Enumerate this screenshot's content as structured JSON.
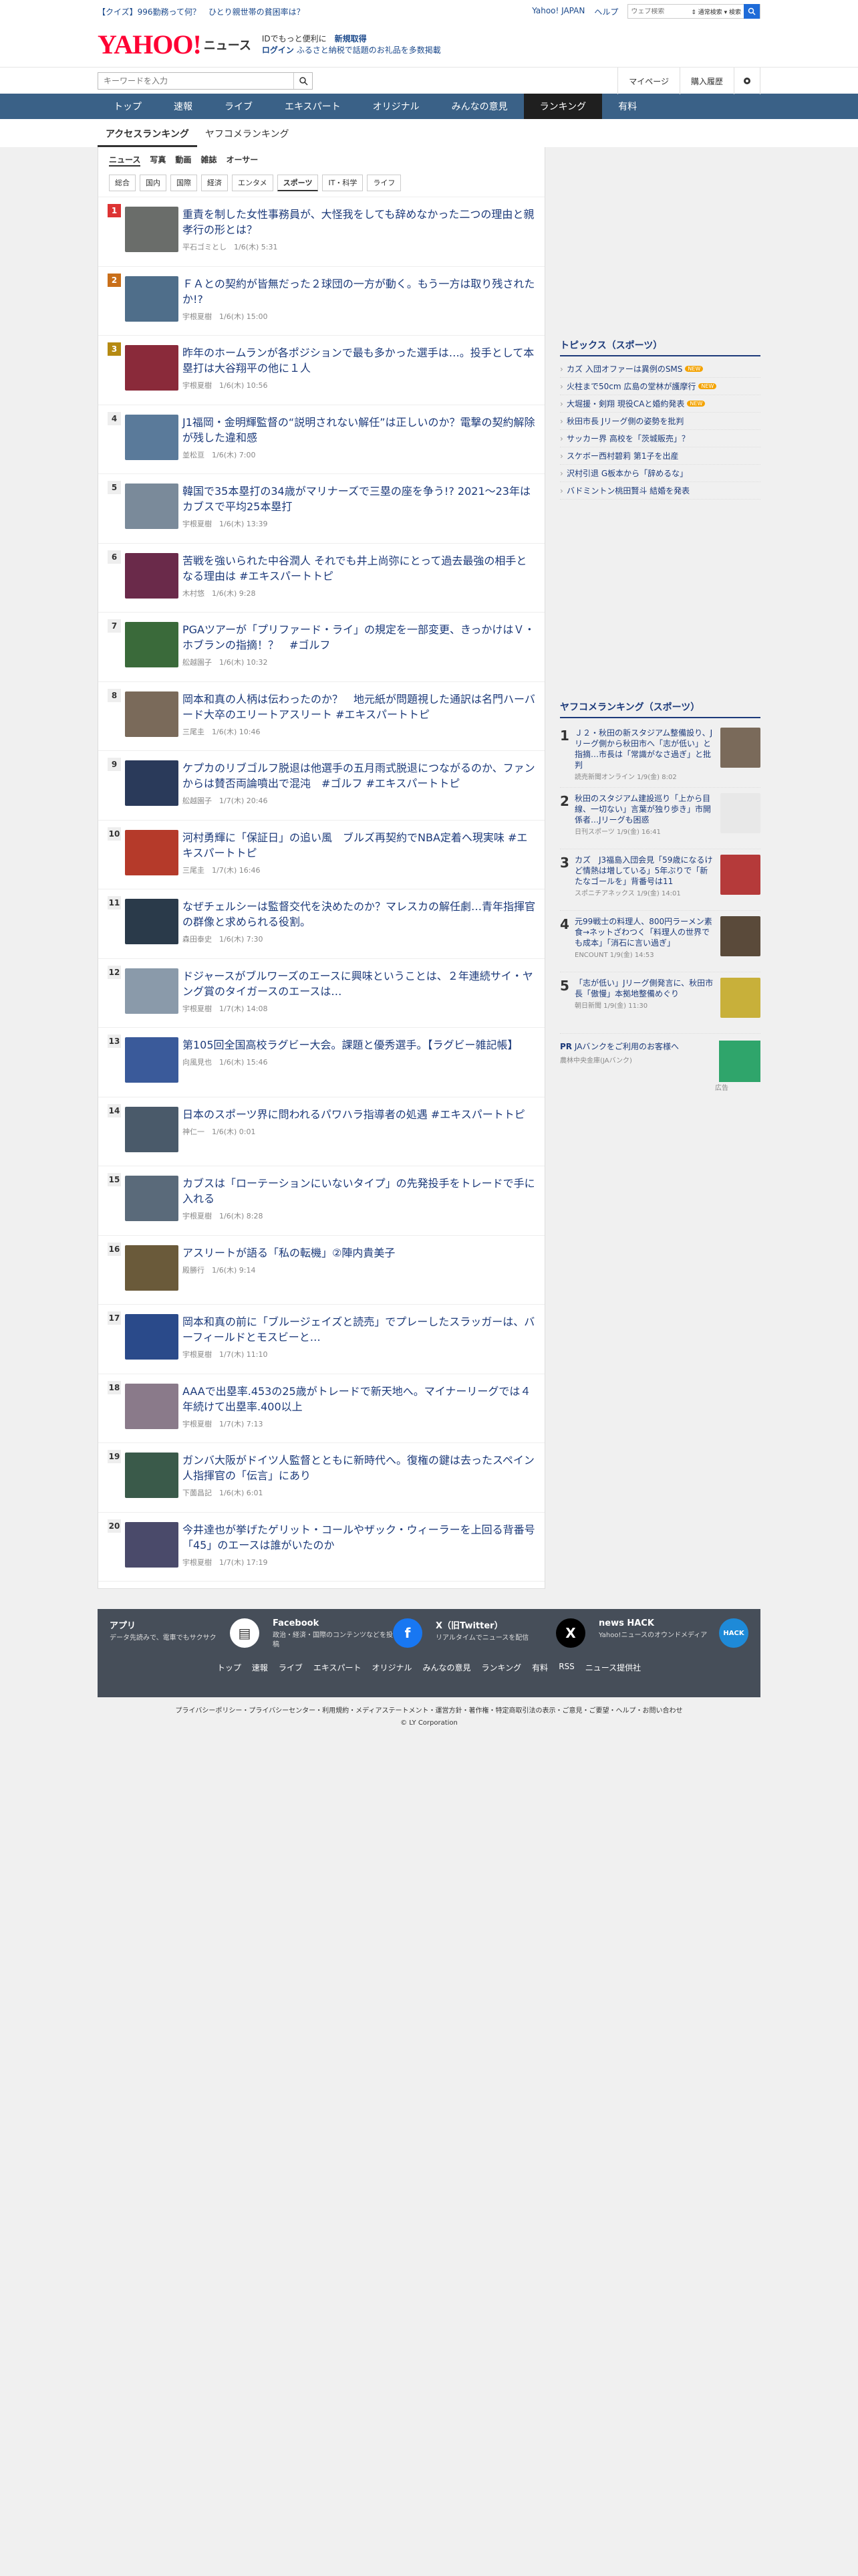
{
  "topbar": {
    "news": "【クイズ】996勤務って何？　ひとり親世帯の貧困率は？",
    "links": [
      "Yahoo! JAPAN",
      "ヘルプ"
    ],
    "search_placeholder": "ウェブ検索",
    "search_option": "⇕ 通常検索 ▾ 検索"
  },
  "header": {
    "logo": "YAHOO!",
    "logo_sub": "JAPAN",
    "brand": "ニュース",
    "promo1": "IDでもっと便利に",
    "promo1b": "新規取得",
    "promo2a": "ログイン",
    "promo2b": "ふるさと納税で話題のお礼品を多数掲載"
  },
  "subbar": {
    "placeholder": "キーワードを入力",
    "mypage": "マイページ",
    "history": "購入履歴"
  },
  "gnav": [
    "トップ",
    "速報",
    "ライブ",
    "エキスパート",
    "オリジナル",
    "みんなの意見",
    "ランキング",
    "有料"
  ],
  "tabs": [
    "アクセスランキング",
    "ヤフコメランキング"
  ],
  "cats": [
    "ニュース",
    "写真",
    "動画",
    "雑誌",
    "オーサー"
  ],
  "subcats": [
    "総合",
    "国内",
    "国際",
    "経済",
    "エンタメ",
    "スポーツ",
    "IT・科学",
    "ライフ"
  ],
  "ranking": [
    {
      "n": "1",
      "title": "重責を制した女性事務員が、大怪我をしても辞めなかった二つの理由と親孝行の形とは？",
      "meta": "平石ゴミとし　1/6(木) 5:31",
      "color": "#d33",
      "thumb": "#6a6d6a"
    },
    {
      "n": "2",
      "title": "ＦＡとの契約が皆無だった２球団の一方が動く。もう一方は取り残されたか!?",
      "meta": "宇根夏樹　1/6(木) 15:00",
      "color": "#c96f1a",
      "thumb": "#4f6e8a"
    },
    {
      "n": "3",
      "title": "昨年のホームランが各ポジションで最も多かった選手は…。投手として本塁打は大谷翔平の他に１人",
      "meta": "宇根夏樹　1/6(木) 10:56",
      "color": "#b58a12",
      "thumb": "#8a2a3a"
    },
    {
      "n": "4",
      "title": "J1福岡・金明輝監督の“説明されない解任”は正しいのか？電撃の契約解除が残した違和感",
      "meta": "並松亘　1/6(木) 7:00",
      "color": "",
      "thumb": "#5a7a9a"
    },
    {
      "n": "5",
      "title": "韓国で35本塁打の34歳がマリナーズで三塁の座を争う!? 2021～23年はカブスで平均25本塁打",
      "meta": "宇根夏樹　1/6(木) 13:39",
      "color": "",
      "thumb": "#7a8a9a"
    },
    {
      "n": "6",
      "title": "苦戦を強いられた中谷潤人 それでも井上尚弥にとって過去最強の相手となる理由は #エキスパートトピ",
      "meta": "木村悠　1/6(木) 9:28",
      "color": "",
      "thumb": "#6a2a4a"
    },
    {
      "n": "7",
      "title": "PGAツアーが「プリファード・ライ」の規定を一部変更、きっかけはＶ・ホブランの指摘！？　#ゴルフ",
      "meta": "舩越園子　1/6(木) 10:32",
      "color": "",
      "thumb": "#3a6a3a"
    },
    {
      "n": "8",
      "title": "岡本和真の人柄は伝わったのか？　地元紙が問題視した通訳は名門ハーバード大卒のエリートアスリート #エキスパートトピ",
      "meta": "三尾圭　1/6(木) 10:46",
      "color": "",
      "thumb": "#7a6a5a"
    },
    {
      "n": "9",
      "title": "ケプカのリブゴルフ脱退は他選手の五月雨式脱退につながるのか、ファンからは賛否両論噴出で混沌　#ゴルフ #エキスパートトピ",
      "meta": "舩越園子　1/7(木) 20:46",
      "color": "",
      "thumb": "#2a3a5a"
    },
    {
      "n": "10",
      "title": "河村勇輝に「保証日」の追い風　ブルズ再契約でNBA定着へ現実味 #エキスパートトピ",
      "meta": "三尾圭　1/7(木) 16:46",
      "color": "",
      "thumb": "#b53a2a"
    },
    {
      "n": "11",
      "title": "なぜチェルシーは監督交代を決めたのか？マレスカの解任劇…青年指揮官の群像と求められる役割。",
      "meta": "森田泰史　1/6(木) 7:30",
      "color": "",
      "thumb": "#2a3a4a"
    },
    {
      "n": "12",
      "title": "ドジャースがブルワーズのエースに興味ということは、２年連続サイ・ヤング賞のタイガースのエースは…",
      "meta": "宇根夏樹　1/7(木) 14:08",
      "color": "",
      "thumb": "#8a9aaa"
    },
    {
      "n": "13",
      "title": "第105回全国高校ラグビー大会。課題と優秀選手。【ラグビー雑記帳】",
      "meta": "向風見也　1/6(木) 15:46",
      "color": "",
      "thumb": "#3a5a9a"
    },
    {
      "n": "14",
      "title": "日本のスポーツ界に問われるパワハラ指導者の処遇 #エキスパートトピ",
      "meta": "神仁一　1/6(木) 0:01",
      "color": "",
      "thumb": "#4a5a6a"
    },
    {
      "n": "15",
      "title": "カブスは「ローテーションにいないタイプ」の先発投手をトレードで手に入れる",
      "meta": "宇根夏樹　1/6(木) 8:28",
      "color": "",
      "thumb": "#5a6a7a"
    },
    {
      "n": "16",
      "title": "アスリートが語る「私の転機」②陣内貴美子",
      "meta": "殿勝行　1/6(木) 9:14",
      "color": "",
      "thumb": "#6a5a3a"
    },
    {
      "n": "17",
      "title": "岡本和真の前に「ブルージェイズと読売」でプレーしたスラッガーは、バーフィールドとモスビーと…",
      "meta": "宇根夏樹　1/7(木) 11:10",
      "color": "",
      "thumb": "#2a4a8a"
    },
    {
      "n": "18",
      "title": "AAAで出塁率.453の25歳がトレードで新天地へ。マイナーリーグでは４年続けて出塁率.400以上",
      "meta": "宇根夏樹　1/7(木) 7:13",
      "color": "",
      "thumb": "#8a7a8a"
    },
    {
      "n": "19",
      "title": "ガンバ大阪がドイツ人監督とともに新時代へ。復権の鍵は去ったスペイン人指揮官の「伝言」にあり",
      "meta": "下薗昌記　1/6(木) 6:01",
      "color": "",
      "thumb": "#3a5a4a"
    },
    {
      "n": "20",
      "title": "今井達也が挙げたゲリット・コールやザック・ウィーラーを上回る背番号「45」のエースは誰がいたのか",
      "meta": "宇根夏樹　1/7(木) 17:19",
      "color": "",
      "thumb": "#4a4a6a"
    }
  ],
  "topics": {
    "heading": "トピックス（スポーツ）",
    "items": [
      {
        "t": "カズ 入団オファーは異例のSMS",
        "new": true
      },
      {
        "t": "火柱まで50cm 広島の堂林が護摩行",
        "new": true
      },
      {
        "t": "大堀援・剣翔 現役CAと婚約発表",
        "new": true
      },
      {
        "t": "秋田市長 Jリーグ側の姿勢を批判",
        "new": false
      },
      {
        "t": "サッカー界 高校を「茨城販売」？",
        "new": false
      },
      {
        "t": "スケボー西村碧莉 第1子を出産",
        "new": false
      },
      {
        "t": "沢村引退 G板本から「辞めるな」",
        "new": false
      },
      {
        "t": "バドミントン桃田賢斗 結婚を発表",
        "new": false
      }
    ],
    "new_label": "NEW"
  },
  "yafuko": {
    "heading": "ヤフコメランキング（スポーツ）",
    "items": [
      {
        "n": "1",
        "t": "Ｊ２・秋田の新スタジアム整備設り、Jリーグ側から秋田市へ「志が低い」と指摘…市長は「常識がなさ過ぎ」と批判",
        "m": "読売新聞オンライン 1/9(金) 8:02",
        "c": "#7a6a5a"
      },
      {
        "n": "2",
        "t": "秋田のスタジアム建設巡り「上から目線、一切ない」言葉が独り歩き」市開係者…Jリーグも困惑",
        "m": "日刊スポーツ 1/9(金) 16:41",
        "c": "#e8e8e8"
      },
      {
        "n": "3",
        "t": "カズ　J3福島入団会見「59歳になるけど情熱は増している」5年ぶりで「新たなゴールを」背番号は11",
        "m": "スポニチアネックス 1/9(金) 14:01",
        "c": "#b53a3a"
      },
      {
        "n": "4",
        "t": "元99戦士の料理人、800円ラーメン素食→ネットざわつく「料理人の世界でも成本」「消石に言い過ぎ」",
        "m": "ENCOUNT 1/9(金) 14:53",
        "c": "#5a4a3a"
      },
      {
        "n": "5",
        "t": "「志が低い」Jリーグ側発言に、秋田市長「傲慢」本拠地整備めぐり",
        "m": "朝日新聞 1/9(金) 11:30",
        "c": "#c8b03a"
      }
    ],
    "pr_label": "PR",
    "pr_text": "JAバンクをご利用のお客様へ",
    "pr_sub": "農林中央金庫(JAバンク)",
    "ad": "広告"
  },
  "footer": {
    "cards": [
      {
        "h": "アプリ",
        "d": "データ先読みで、電車でもサクサク",
        "ic": "▤",
        "bg": "#fff",
        "fg": "#333"
      },
      {
        "h": "Facebook",
        "d": "政治・経済・国際のコンテンツなどを投稿",
        "ic": "f",
        "bg": "#1877f2",
        "fg": "#fff"
      },
      {
        "h": "X（旧Twitter）",
        "d": "リアルタイムでニュースを配信",
        "ic": "X",
        "bg": "#000",
        "fg": "#fff"
      },
      {
        "h": "news HACK",
        "d": "Yahoo!ニュースのオウンドメディア",
        "ic": "HACK",
        "bg": "#1e8ad8",
        "fg": "#fff"
      }
    ],
    "links": [
      "トップ",
      "速報",
      "ライブ",
      "エキスパート",
      "オリジナル",
      "みんなの意見",
      "ランキング",
      "有料",
      "RSS",
      "ニュース提供社"
    ],
    "legal": "プライバシーポリシー・プライバシーセンター・利用規約・メディアステートメント・運営方針・著作権・特定商取引法の表示・ご意見・ご要望・ヘルプ・お問い合わせ",
    "copy": "© LY Corporation"
  }
}
